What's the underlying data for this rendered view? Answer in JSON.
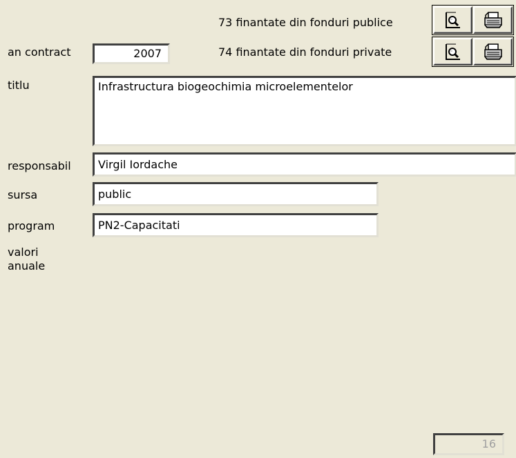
{
  "reports": {
    "public_label": "73 finantate din fonduri publice",
    "private_label": "74 finantate din fonduri private"
  },
  "form": {
    "an_contract": {
      "label": "an contract",
      "value": "2007"
    },
    "titlu": {
      "label": "titlu",
      "value": "Infrastructura biogeochimia microelementelor"
    },
    "responsabil": {
      "label": "responsabil",
      "value": "Virgil Iordache"
    },
    "sursa": {
      "label": "sursa",
      "value": "public"
    },
    "program": {
      "label": "program",
      "value": "PN2-Capacitati"
    },
    "valori_anuale": {
      "label_line1": "valori",
      "label_line2": "anuale"
    }
  },
  "record_counter": "16",
  "icons": {
    "preview": "print-preview-icon",
    "print": "printer-icon"
  }
}
